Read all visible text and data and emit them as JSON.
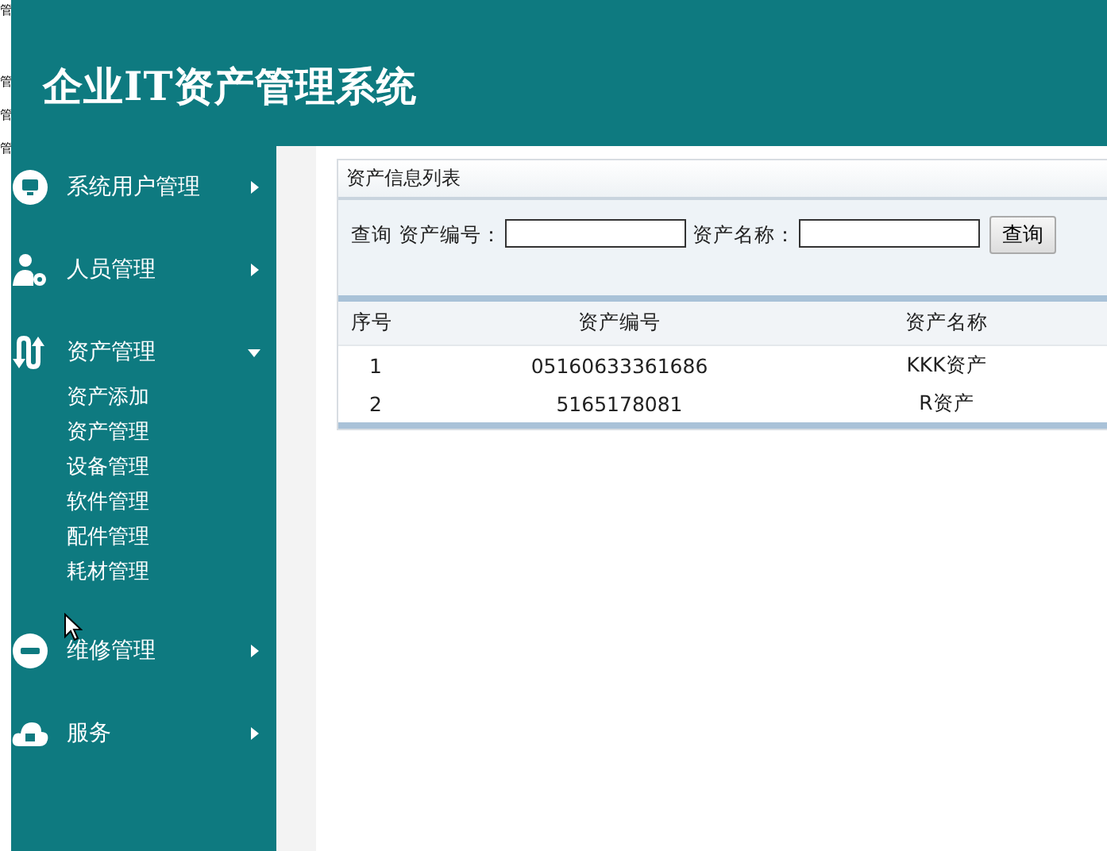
{
  "edge_strip": [
    "管",
    "管",
    "管",
    "管"
  ],
  "header": {
    "title": "企业IT资产管理系统"
  },
  "sidebar": {
    "items": [
      {
        "label": "系统用户管理",
        "kind": "monitor",
        "expanded": false
      },
      {
        "label": "人员管理",
        "kind": "person",
        "expanded": false
      },
      {
        "label": "资产管理",
        "kind": "arrows",
        "expanded": true,
        "children": [
          {
            "label": "资产添加"
          },
          {
            "label": "资产管理"
          },
          {
            "label": "设备管理"
          },
          {
            "label": "软件管理"
          },
          {
            "label": "配件管理"
          },
          {
            "label": "耗材管理"
          }
        ]
      },
      {
        "label": "维修管理",
        "kind": "app",
        "expanded": false
      },
      {
        "label": "服务",
        "kind": "cloud",
        "expanded": false
      }
    ]
  },
  "panel": {
    "title": "资产信息列表",
    "search": {
      "label": "查询",
      "fields": [
        {
          "label": "资产编号："
        },
        {
          "label": "资产名称："
        }
      ],
      "button": "查询"
    },
    "table": {
      "columns": [
        "序号",
        "资产编号",
        "资产名称"
      ],
      "rows": [
        [
          "1",
          "05160633361686",
          "KKK资产"
        ],
        [
          "2",
          "5165178081",
          "R资产"
        ]
      ]
    }
  }
}
